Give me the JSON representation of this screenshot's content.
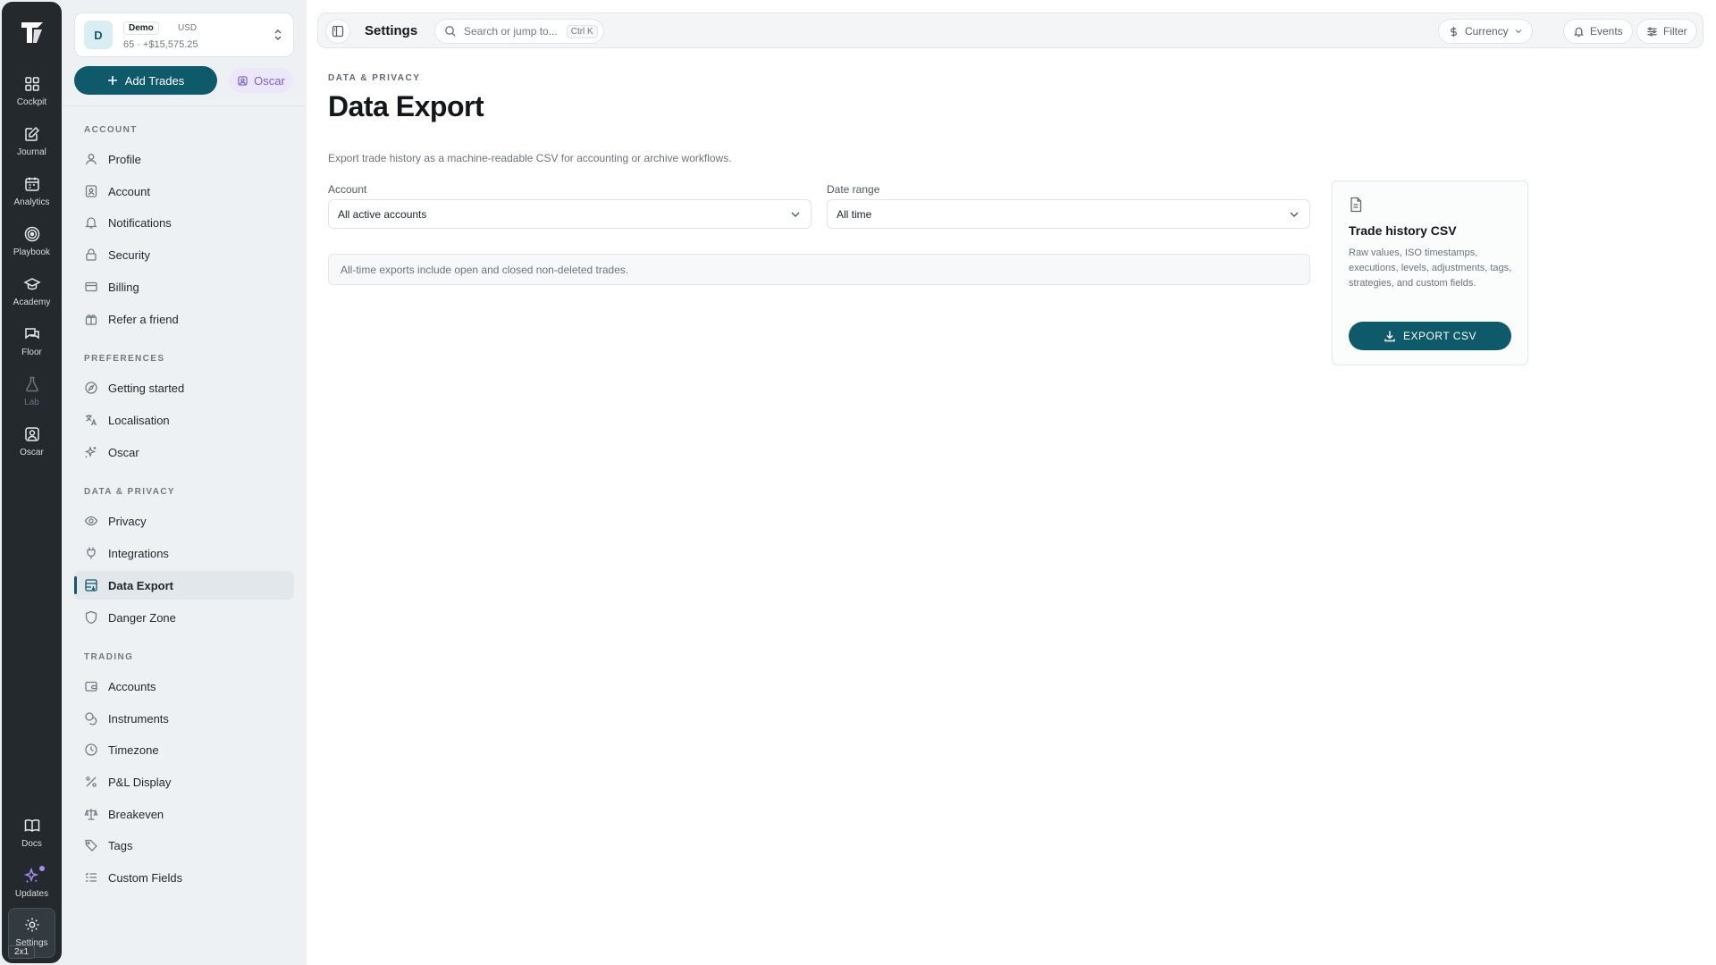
{
  "rail": {
    "items": [
      {
        "label": "Cockpit",
        "icon": "grid-icon"
      },
      {
        "label": "Journal",
        "icon": "journal-icon"
      },
      {
        "label": "Analytics",
        "icon": "calendar-icon"
      },
      {
        "label": "Playbook",
        "icon": "target-icon"
      },
      {
        "label": "Academy",
        "icon": "graduation-cap-icon"
      },
      {
        "label": "Floor",
        "icon": "chat-icon"
      },
      {
        "label": "Lab",
        "icon": "flask-icon"
      },
      {
        "label": "Oscar",
        "icon": "oscar-icon"
      }
    ],
    "bottom": [
      {
        "label": "Docs",
        "icon": "book-icon"
      },
      {
        "label": "Updates",
        "icon": "sparkle-icon"
      },
      {
        "label": "Settings",
        "icon": "gear-icon"
      }
    ],
    "badge": "2x1"
  },
  "account_card": {
    "avatar": "D",
    "mode": "Demo",
    "currency": "USD",
    "balance": "65 · +$15,575.25"
  },
  "add_trades_label": "Add Trades",
  "oscar_chip_label": "Oscar",
  "sidebar": {
    "sections": [
      {
        "title": "ACCOUNT",
        "items": [
          "Profile",
          "Account",
          "Notifications",
          "Security",
          "Billing",
          "Refer a friend"
        ]
      },
      {
        "title": "PREFERENCES",
        "items": [
          "Getting started",
          "Localisation",
          "Oscar"
        ]
      },
      {
        "title": "DATA & PRIVACY",
        "items": [
          "Privacy",
          "Integrations",
          "Data Export",
          "Danger Zone"
        ]
      },
      {
        "title": "TRADING",
        "items": [
          "Accounts",
          "Instruments",
          "Timezone",
          "P&L Display",
          "Breakeven",
          "Tags",
          "Custom Fields"
        ]
      }
    ],
    "active_item": "Data Export"
  },
  "topbar": {
    "title": "Settings",
    "search_placeholder": "Search or jump to...",
    "search_shortcut": "Ctrl K",
    "currency_label": "Currency",
    "events_label": "Events",
    "filter_label": "Filter"
  },
  "page": {
    "eyebrow": "DATA & PRIVACY",
    "title": "Data Export",
    "description": "Export trade history as a machine-readable CSV for accounting or archive workflows.",
    "account_label": "Account",
    "account_value": "All active accounts",
    "date_label": "Date range",
    "date_value": "All time",
    "info": "All-time exports include open and closed non-deleted trades."
  },
  "export_card": {
    "title": "Trade history CSV",
    "description": "Raw values, ISO timestamps, executions, levels, adjustments, tags, strategies, and custom fields.",
    "button": "EXPORT CSV"
  },
  "colors": {
    "accent": "#0e5a6a",
    "rail": "#23292d",
    "oscar": "#7b5fd1"
  }
}
